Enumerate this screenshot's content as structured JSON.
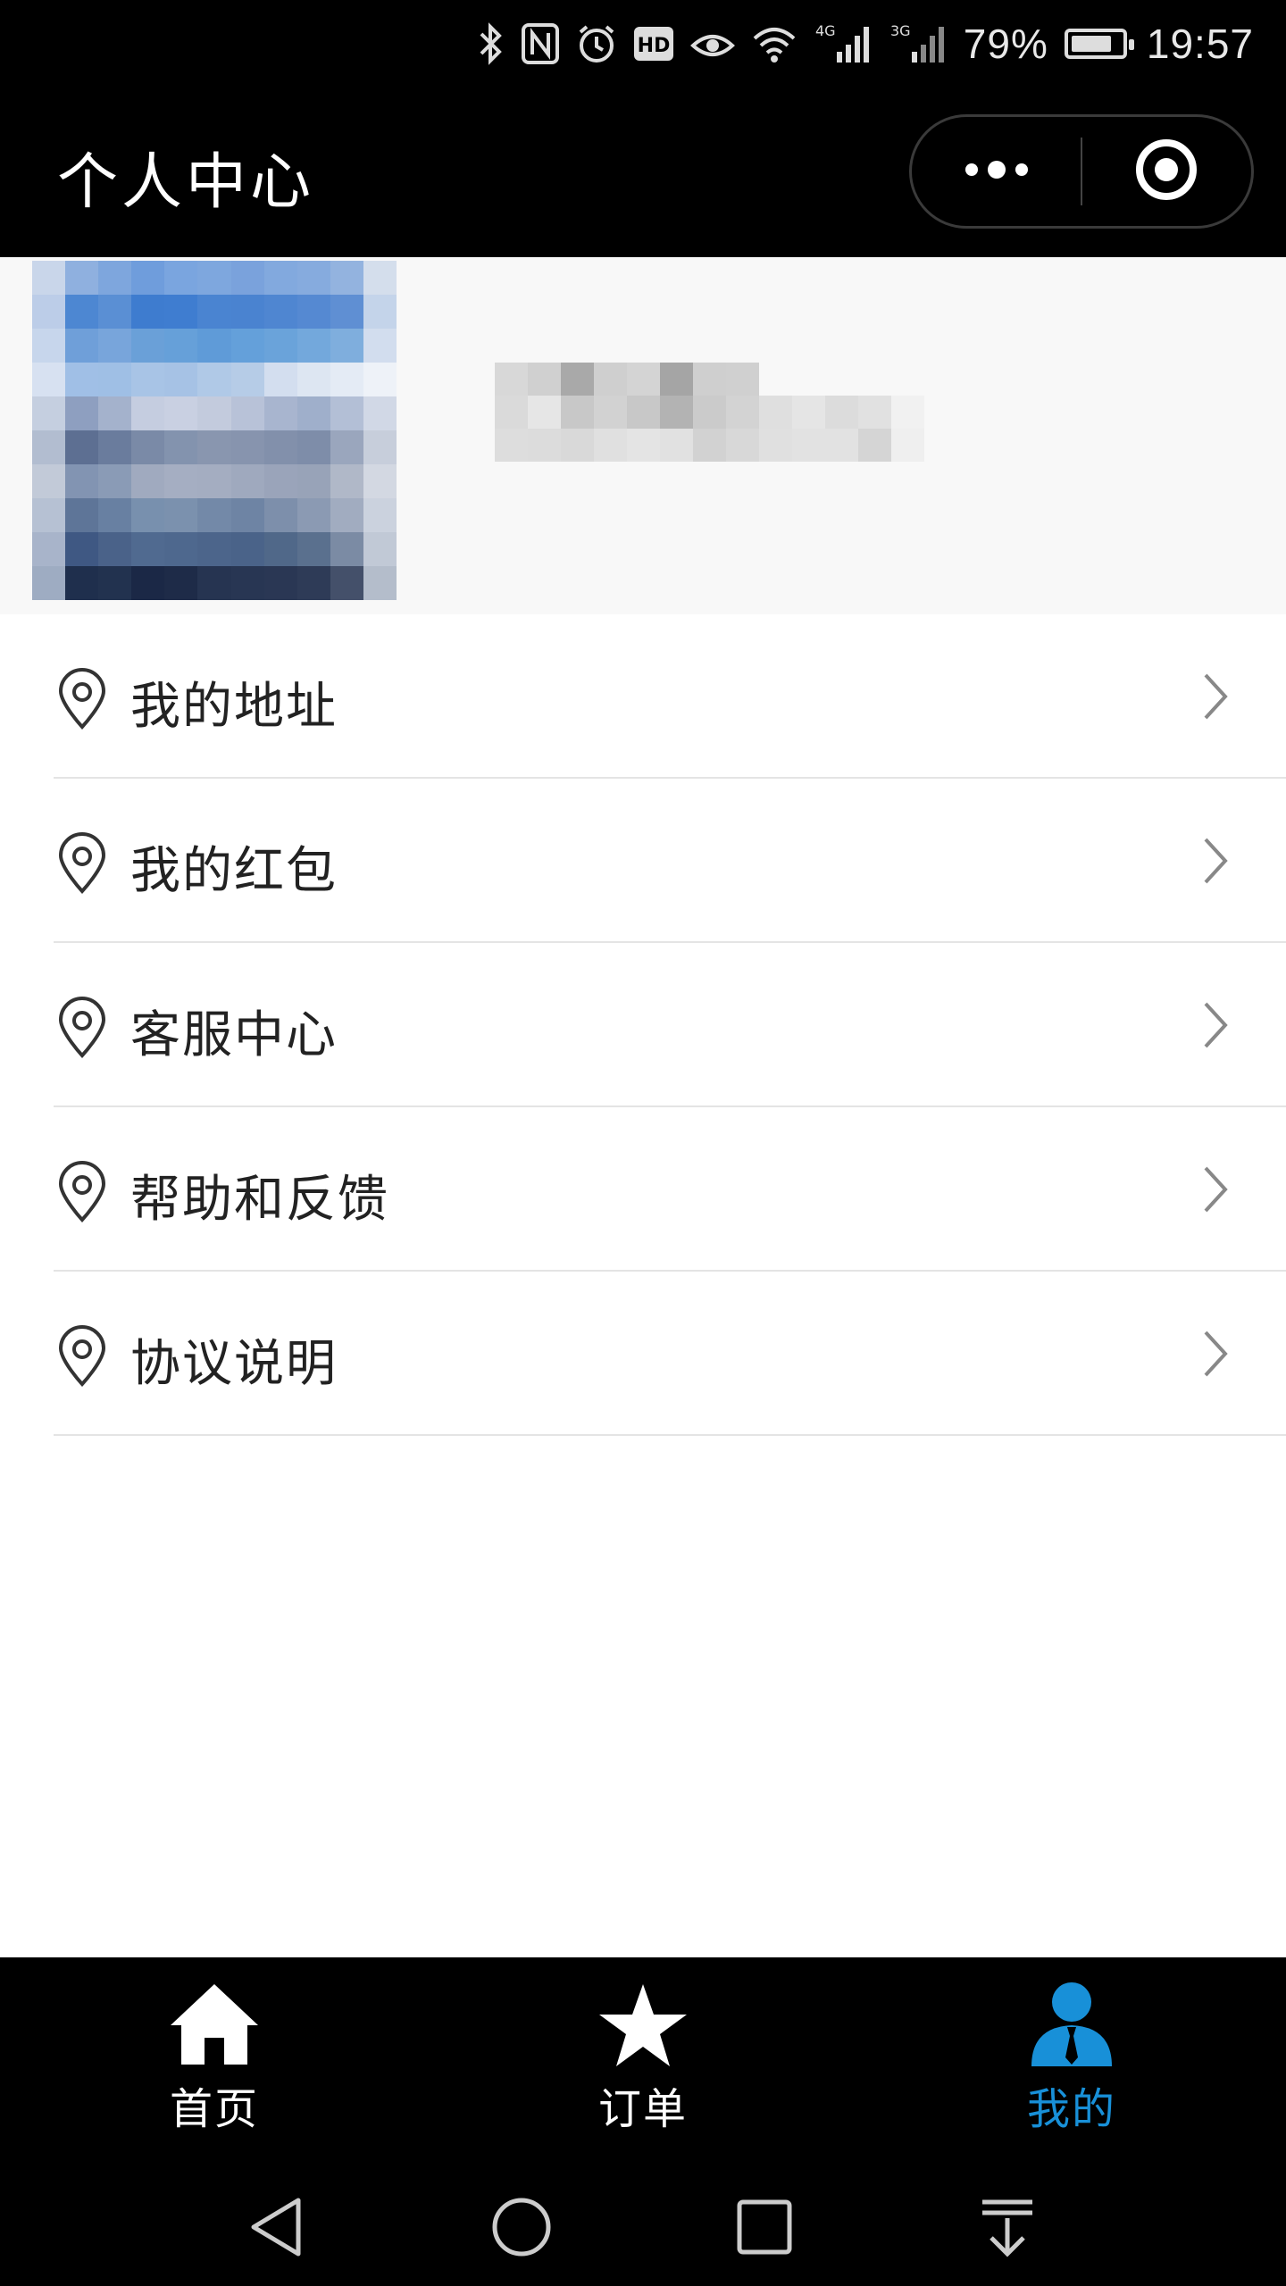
{
  "status_bar": {
    "battery": "79%",
    "time": "19:57",
    "signal_a": "4G",
    "signal_b": "3G",
    "icons": [
      "bluetooth-icon",
      "nfc-icon",
      "alarm-icon",
      "hd-icon",
      "eye-comfort-icon",
      "wifi-icon",
      "signal-icon",
      "battery-icon"
    ]
  },
  "header": {
    "title": "个人中心",
    "more_icon": "more-dots-icon",
    "close_icon": "target-close-icon"
  },
  "profile": {
    "avatar": "pixelated-avatar",
    "name_redacted": true
  },
  "menu": {
    "items": [
      {
        "label": "我的地址",
        "icon": "location-pin-icon"
      },
      {
        "label": "我的红包",
        "icon": "location-pin-icon"
      },
      {
        "label": "客服中心",
        "icon": "location-pin-icon"
      },
      {
        "label": "帮助和反馈",
        "icon": "location-pin-icon"
      },
      {
        "label": "协议说明",
        "icon": "location-pin-icon"
      }
    ]
  },
  "tabbar": {
    "tabs": [
      {
        "label": "首页",
        "icon": "home-icon",
        "active": false
      },
      {
        "label": "订单",
        "icon": "star-icon",
        "active": false
      },
      {
        "label": "我的",
        "icon": "user-icon",
        "active": true
      }
    ],
    "active_color": "#1890d8",
    "inactive_color": "#ffffff"
  },
  "system_nav": {
    "buttons": [
      "back-icon",
      "home-circle-icon",
      "recents-icon",
      "notification-pulldown-icon"
    ]
  },
  "colors": {
    "header_bg": "#000000",
    "profile_bg": "#f8f8f8",
    "divider": "#e4e4e4",
    "text": "#222222"
  }
}
